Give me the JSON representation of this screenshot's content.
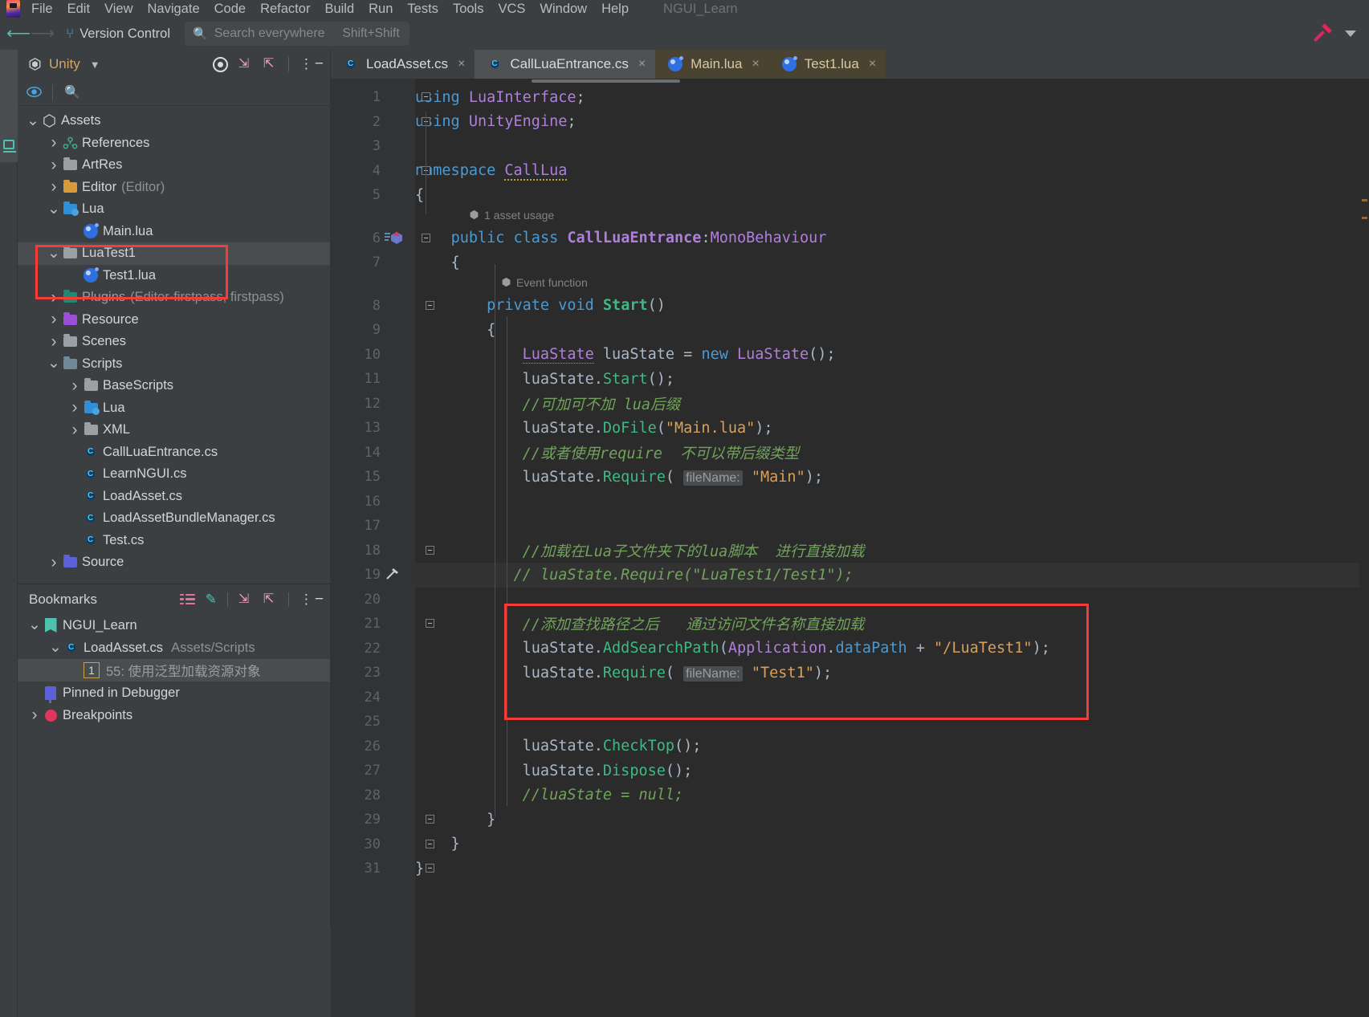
{
  "window": {
    "project_name": "NGUI_Learn",
    "menu": [
      "File",
      "Edit",
      "View",
      "Navigate",
      "Code",
      "Refactor",
      "Build",
      "Run",
      "Tests",
      "Tools",
      "VCS",
      "Window",
      "Help"
    ]
  },
  "toolbar": {
    "back_icon": "arrow-left-icon",
    "forward_icon": "arrow-right-icon",
    "vcs_label": "Version Control",
    "vcs_icon": "branch-icon",
    "search_placeholder": "Search everywhere",
    "search_shortcut": "Shift+Shift",
    "build_icon": "hammer-icon",
    "more_icon": "chevron-down-icon"
  },
  "left_stripe": {
    "tab_label": "Explorer",
    "tab_icon": "explorer-icon"
  },
  "project_panel": {
    "title": "Unity",
    "chevron": "chevron-down-icon",
    "tools": [
      "target-icon",
      "expand-icon",
      "collapse-icon",
      "kebab-icon",
      "minimize-icon"
    ],
    "subbar": [
      "eye-icon",
      "search-icon"
    ],
    "tree": [
      {
        "label": "Assets",
        "suffix": "",
        "indent": 0,
        "twisty": "v",
        "icon": "unity-asset-icon",
        "selected": false,
        "dim": false
      },
      {
        "label": "References",
        "suffix": "",
        "indent": 1,
        "twisty": ">",
        "icon": "references-icon",
        "selected": false,
        "dim": false
      },
      {
        "label": "ArtRes",
        "suffix": "",
        "indent": 1,
        "twisty": ">",
        "icon": "folder-gray-icon",
        "selected": false,
        "dim": false
      },
      {
        "label": "Editor",
        "suffix": "(Editor)",
        "indent": 1,
        "twisty": ">",
        "icon": "folder-orange-icon",
        "selected": false,
        "dim": false
      },
      {
        "label": "Lua",
        "suffix": "",
        "indent": 1,
        "twisty": "v",
        "icon": "folder-lua-icon",
        "selected": false,
        "dim": false
      },
      {
        "label": "Main.lua",
        "suffix": "",
        "indent": 2,
        "twisty": "",
        "icon": "lua-file-icon",
        "selected": false,
        "dim": false
      },
      {
        "label": "LuaTest1",
        "suffix": "",
        "indent": 1,
        "twisty": "v",
        "icon": "folder-gray-icon",
        "selected": true,
        "dim": false
      },
      {
        "label": "Test1.lua",
        "suffix": "",
        "indent": 2,
        "twisty": "",
        "icon": "lua-file-icon",
        "selected": false,
        "dim": false
      },
      {
        "label": "Plugins",
        "suffix": "(Editor-firstpass, firstpass)",
        "indent": 1,
        "twisty": ">",
        "icon": "folder-teal-icon",
        "selected": false,
        "dim": true
      },
      {
        "label": "Resource",
        "suffix": "",
        "indent": 1,
        "twisty": ">",
        "icon": "folder-purple-icon",
        "selected": false,
        "dim": false
      },
      {
        "label": "Scenes",
        "suffix": "",
        "indent": 1,
        "twisty": ">",
        "icon": "folder-gray-icon",
        "selected": false,
        "dim": false
      },
      {
        "label": "Scripts",
        "suffix": "",
        "indent": 1,
        "twisty": "v",
        "icon": "folder-slate-icon",
        "selected": false,
        "dim": false
      },
      {
        "label": "BaseScripts",
        "suffix": "",
        "indent": 2,
        "twisty": ">",
        "icon": "folder-gray-icon",
        "selected": false,
        "dim": false
      },
      {
        "label": "Lua",
        "suffix": "",
        "indent": 2,
        "twisty": ">",
        "icon": "folder-lua-icon",
        "selected": false,
        "dim": false
      },
      {
        "label": "XML",
        "suffix": "",
        "indent": 2,
        "twisty": ">",
        "icon": "folder-gray-icon",
        "selected": false,
        "dim": false
      },
      {
        "label": "CallLuaEntrance.cs",
        "suffix": "",
        "indent": 2,
        "twisty": "",
        "icon": "csharp-file-icon",
        "selected": false,
        "dim": false
      },
      {
        "label": "LearnNGUI.cs",
        "suffix": "",
        "indent": 2,
        "twisty": "",
        "icon": "csharp-file-icon",
        "selected": false,
        "dim": false
      },
      {
        "label": "LoadAsset.cs",
        "suffix": "",
        "indent": 2,
        "twisty": "",
        "icon": "csharp-file-icon",
        "selected": false,
        "dim": false
      },
      {
        "label": "LoadAssetBundleManager.cs",
        "suffix": "",
        "indent": 2,
        "twisty": "",
        "icon": "csharp-file-icon",
        "selected": false,
        "dim": false
      },
      {
        "label": "Test.cs",
        "suffix": "",
        "indent": 2,
        "twisty": "",
        "icon": "csharp-file-icon",
        "selected": false,
        "dim": false
      },
      {
        "label": "Source",
        "suffix": "",
        "indent": 1,
        "twisty": ">",
        "icon": "folder-indigo-icon",
        "selected": false,
        "dim": false
      }
    ]
  },
  "bookmarks_panel": {
    "title": "Bookmarks",
    "tools": [
      "list-icon",
      "pencil-icon",
      "expand-icon",
      "collapse-icon",
      "kebab-icon",
      "minimize-icon"
    ],
    "items": [
      {
        "kind": "group",
        "label": "NGUI_Learn",
        "path": "",
        "twisty": "v",
        "icon": "bookmark-flag-icon",
        "selected": false,
        "num": ""
      },
      {
        "kind": "file",
        "label": "LoadAsset.cs",
        "path": "Assets/Scripts",
        "twisty": "v",
        "icon": "csharp-file-icon",
        "selected": false,
        "num": ""
      },
      {
        "kind": "line",
        "label": "55: 使用泛型加载资源对象",
        "path": "",
        "twisty": "",
        "icon": "",
        "selected": true,
        "num": "1"
      },
      {
        "kind": "group",
        "label": "Pinned in Debugger",
        "path": "",
        "twisty": "",
        "icon": "pin-icon",
        "selected": false,
        "num": ""
      },
      {
        "kind": "group",
        "label": "Breakpoints",
        "path": "",
        "twisty": ">",
        "icon": "breakpoint-icon",
        "selected": false,
        "num": ""
      }
    ]
  },
  "editor": {
    "tabs": [
      {
        "label": "LoadAsset.cs",
        "icon": "csharp-file-icon",
        "state": "inactive-cs",
        "close": "×"
      },
      {
        "label": "CallLuaEntrance.cs",
        "icon": "csharp-file-icon",
        "state": "active-cs",
        "close": "×"
      },
      {
        "label": "Main.lua",
        "icon": "lua-file-icon",
        "state": "lua",
        "close": "×"
      },
      {
        "label": "Test1.lua",
        "icon": "lua-file-icon",
        "state": "lua",
        "close": "×"
      }
    ],
    "hints": [
      {
        "line": 6,
        "text": "1 asset usage"
      },
      {
        "line": 8,
        "text": "Event function"
      }
    ],
    "lines": [
      {
        "n": 1,
        "text": "using LuaInterface;"
      },
      {
        "n": 2,
        "text": "using UnityEngine;"
      },
      {
        "n": 3,
        "text": ""
      },
      {
        "n": 4,
        "text": "namespace CallLua"
      },
      {
        "n": 5,
        "text": "{"
      },
      {
        "n": 6,
        "text": "    public class CallLuaEntrance:MonoBehaviour"
      },
      {
        "n": 7,
        "text": "    {"
      },
      {
        "n": 8,
        "text": "        private void Start()"
      },
      {
        "n": 9,
        "text": "        {"
      },
      {
        "n": 10,
        "text": "            LuaState luaState = new LuaState();"
      },
      {
        "n": 11,
        "text": "            luaState.Start();"
      },
      {
        "n": 12,
        "text": "            //可加可不加 lua后缀"
      },
      {
        "n": 13,
        "text": "            luaState.DoFile(\"Main.lua\");"
      },
      {
        "n": 14,
        "text": "            //或者使用require  不可以带后缀类型"
      },
      {
        "n": 15,
        "text": "            luaState.Require( fileName: \"Main\");"
      },
      {
        "n": 16,
        "text": ""
      },
      {
        "n": 17,
        "text": ""
      },
      {
        "n": 18,
        "text": "            //加载在Lua子文件夹下的lua脚本  进行直接加载"
      },
      {
        "n": 19,
        "text": "           // luaState.Require(\"LuaTest1/Test1\");"
      },
      {
        "n": 20,
        "text": ""
      },
      {
        "n": 21,
        "text": "            //添加查找路径之后   通过访问文件名称直接加载"
      },
      {
        "n": 22,
        "text": "            luaState.AddSearchPath(Application.dataPath + \"/LuaTest1\");"
      },
      {
        "n": 23,
        "text": "            luaState.Require( fileName: \"Test1\");"
      },
      {
        "n": 24,
        "text": ""
      },
      {
        "n": 25,
        "text": ""
      },
      {
        "n": 26,
        "text": "            luaState.CheckTop();"
      },
      {
        "n": 27,
        "text": "            luaState.Dispose();"
      },
      {
        "n": 28,
        "text": "            //luaState = null;"
      },
      {
        "n": 29,
        "text": "        }"
      },
      {
        "n": 30,
        "text": "    }"
      },
      {
        "n": 31,
        "text": "}"
      }
    ]
  },
  "annotations": {
    "tree_box_label": "red-highlight-tree",
    "code_box_label": "red-highlight-code",
    "color": "#f73c38"
  }
}
